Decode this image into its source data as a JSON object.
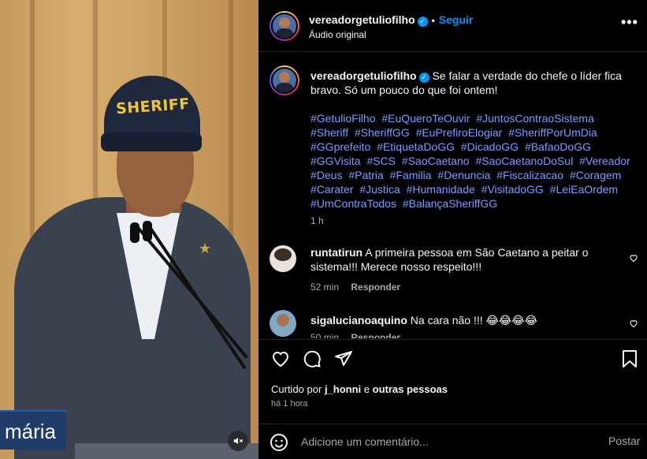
{
  "video": {
    "cap_text": "SHERIFF",
    "lower_third": "mária",
    "mute_icon": "speaker-muted-icon"
  },
  "header": {
    "username": "vereadorgetuliofilho",
    "separator": "•",
    "follow_label": "Seguir",
    "audio_label": "Áudio original",
    "more_icon": "more-options-icon",
    "more_label": "•••"
  },
  "caption": {
    "username": "vereadorgetuliofilho",
    "text": "Se falar a verdade do chefe o líder fica bravo. Só um pouco do que foi ontem!",
    "hashtags": [
      "#GetulioFilho",
      "#EuQueroTeOuvir",
      "#JuntosContraoSistema",
      "#Sheriff",
      "#SheriffGG",
      "#EuPrefiroElogiar",
      "#SheriffPorUmDia",
      "#GGprefeito",
      "#EtiquetaDoGG",
      "#DicadoGG",
      "#BafaoDoGG",
      "#GGVisita",
      "#SCS",
      "#SaoCaetano",
      "#SaoCaetanoDoSul",
      "#Vereador",
      "#Deus",
      "#Patria",
      "#Familia",
      "#Denuncia",
      "#Fiscalizacao",
      "#Coragem",
      "#Carater",
      "#Justica",
      "#Humanidade",
      "#VisitadoGG",
      "#LeiEaOrdem",
      "#UmContraTodos",
      "#BalançaSheriffGG"
    ],
    "time": "1 h"
  },
  "comments": [
    {
      "username": "runtatirun",
      "text": "A primeira pessoa em São Caetano a peitar o sistema!!! Merece nosso respeito!!!",
      "time": "52 min",
      "reply_label": "Responder"
    },
    {
      "username": "sigalucianoaquino",
      "text": "Na cara não !!! 😂😂😂😂",
      "time": "50 min",
      "reply_label": "Responder"
    }
  ],
  "actions": {
    "like_icon": "heart-icon",
    "comment_icon": "comment-icon",
    "share_icon": "share-icon",
    "save_icon": "bookmark-icon"
  },
  "likes": {
    "prefix": "Curtido por",
    "user": "j_honni",
    "conj": "e",
    "others": "outras pessoas"
  },
  "post_time": "há 1 hora",
  "add_comment": {
    "placeholder": "Adicione um comentário...",
    "post_label": "Postar",
    "emoji_icon": "emoji-icon"
  },
  "colors": {
    "accent": "#0095f6",
    "hashtag": "#7c9bff",
    "muted": "#a8a8a8",
    "background": "#000000"
  }
}
